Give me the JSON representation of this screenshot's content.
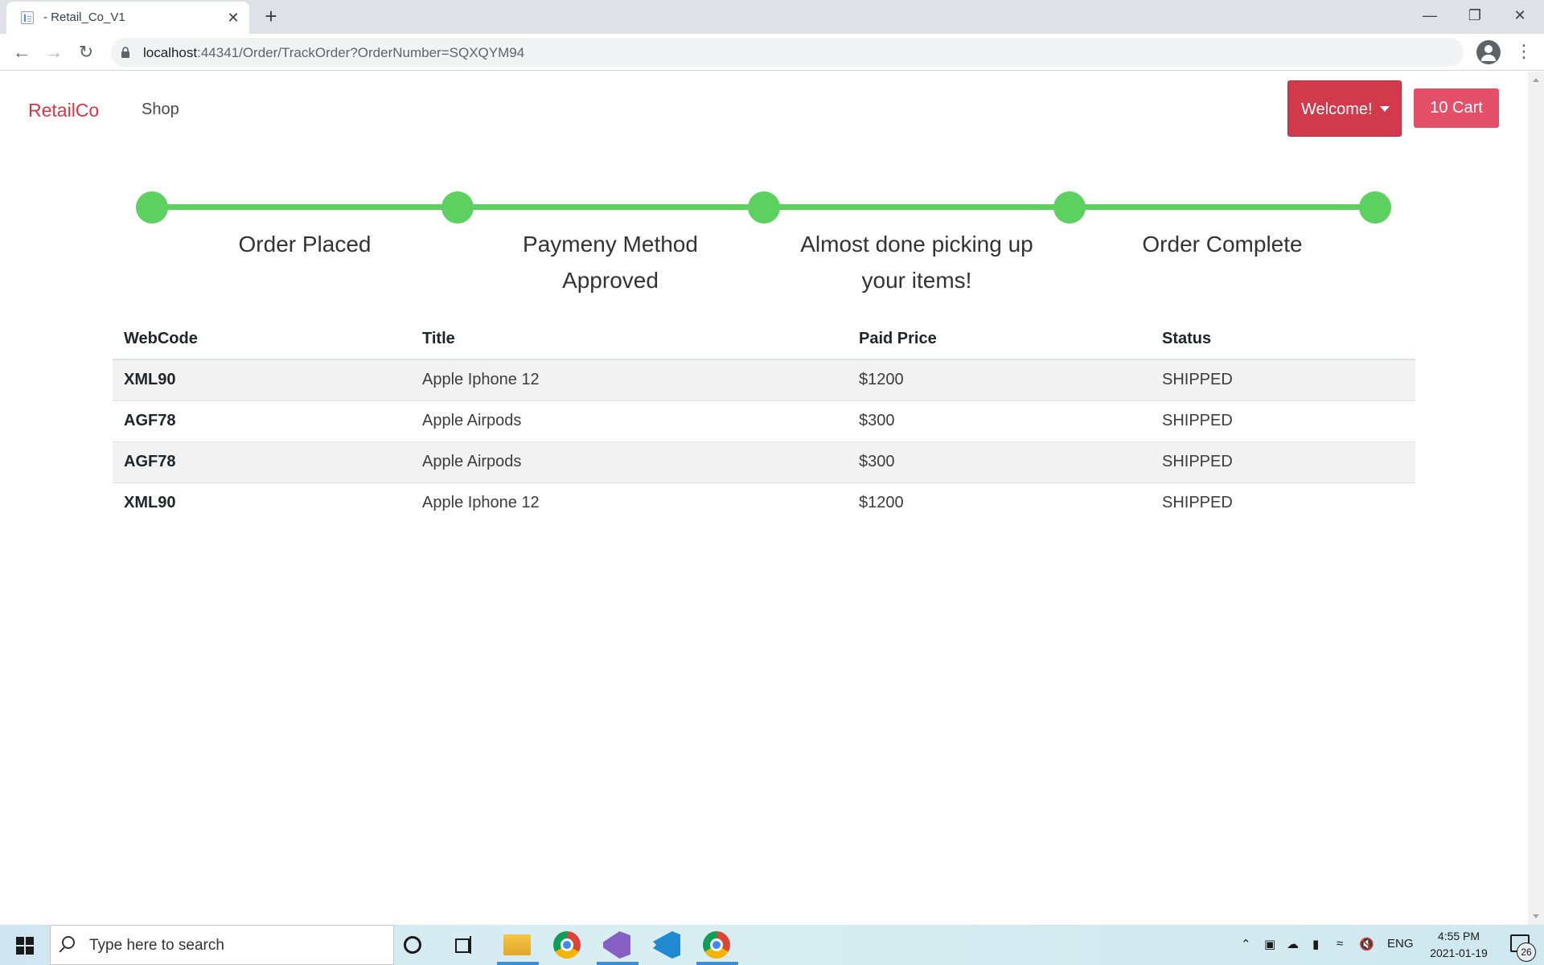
{
  "browser": {
    "tab_title": "- Retail_Co_V1",
    "url_host": "localhost",
    "url_rest": ":44341/Order/TrackOrder?OrderNumber=SQXQYM94"
  },
  "navbar": {
    "brand": "RetailCo",
    "shop_link": "Shop",
    "welcome_label": "Welcome!",
    "cart_label": "10 Cart"
  },
  "tracker": {
    "color": "#5cd160",
    "steps": [
      {
        "label": "Order Placed"
      },
      {
        "label": "Paymeny Method Approved"
      },
      {
        "label": "Almost done picking up your items!"
      },
      {
        "label": "Order Complete"
      }
    ]
  },
  "table": {
    "headers": [
      "WebCode",
      "Title",
      "Paid Price",
      "Status"
    ],
    "rows": [
      [
        "XML90",
        "Apple Iphone 12",
        "$1200",
        "SHIPPED"
      ],
      [
        "AGF78",
        "Apple Airpods",
        "$300",
        "SHIPPED"
      ],
      [
        "AGF78",
        "Apple Airpods",
        "$300",
        "SHIPPED"
      ],
      [
        "XML90",
        "Apple Iphone 12",
        "$1200",
        "SHIPPED"
      ]
    ]
  },
  "taskbar": {
    "search_placeholder": "Type here to search",
    "language": "ENG",
    "time": "4:55 PM",
    "date": "2021-01-19",
    "notification_count": "26"
  },
  "colors": {
    "brand": "#dc3545",
    "welcome_button": "#d13a4b",
    "cart_button": "#e4506a"
  }
}
